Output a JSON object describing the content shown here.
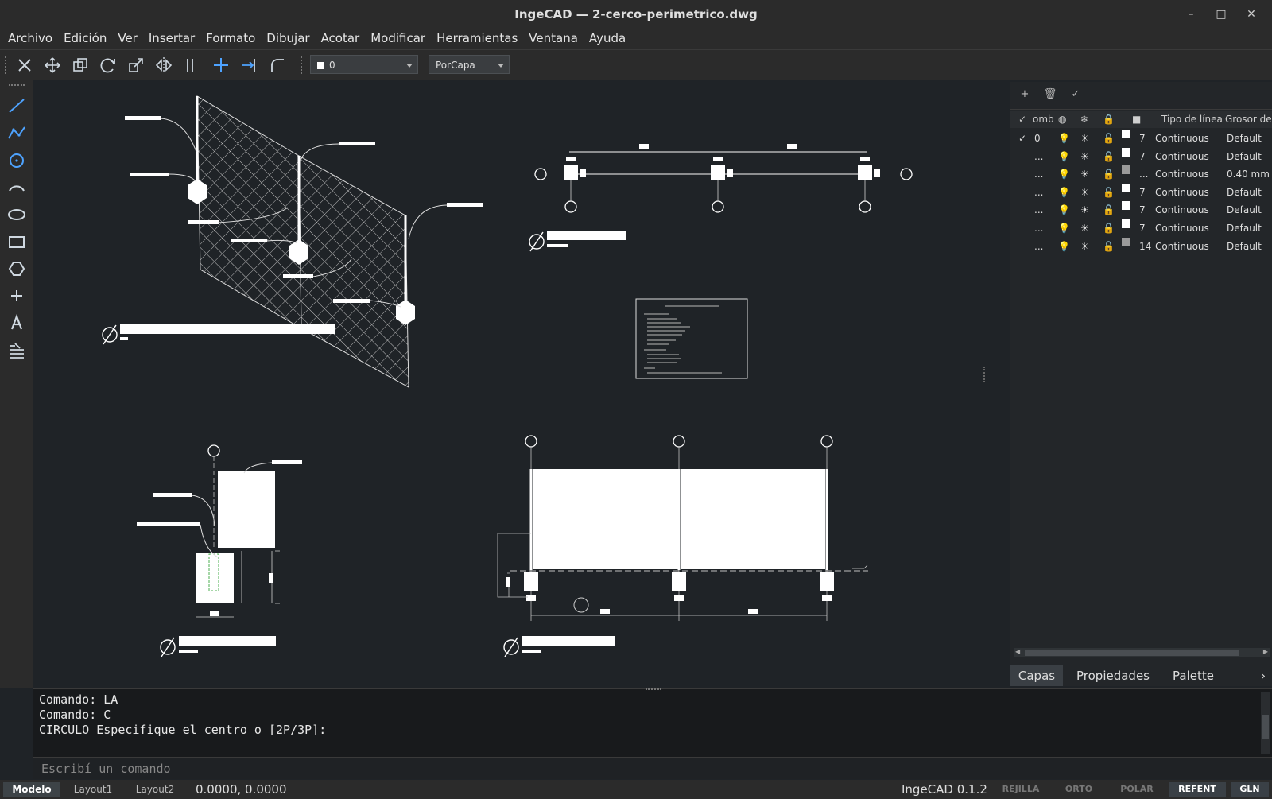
{
  "window": {
    "title": "IngeCAD — 2-cerco-perimetrico.dwg",
    "controls": [
      "–",
      "□",
      "✕"
    ]
  },
  "menu": [
    "Archivo",
    "Edición",
    "Ver",
    "Insertar",
    "Formato",
    "Dibujar",
    "Acotar",
    "Modificar",
    "Herramientas",
    "Ventana",
    "Ayuda"
  ],
  "toolbar": {
    "tools": [
      "erase-icon",
      "move-icon",
      "copy-icon",
      "rotate-icon",
      "scale-icon",
      "mirror-icon",
      "offset-icon",
      "trim-icon",
      "extend-icon",
      "fillet-icon"
    ],
    "layer_value": "0",
    "linetype_value": "PorCapa"
  },
  "left_tools": [
    "line-icon",
    "polyline-icon",
    "circle-icon",
    "arc-icon",
    "ellipse-icon",
    "rectangle-icon",
    "polygon-icon",
    "point-icon",
    "text-icon",
    "hatch-icon"
  ],
  "layers_panel": {
    "toolbar": [
      "+",
      "🗑",
      "✓"
    ],
    "columns": {
      "check": "✓",
      "name": "omb",
      "linetype": "Tipo de línea",
      "lineweight": "Grosor de lí"
    },
    "rows": [
      {
        "current": "✓",
        "name": "0",
        "color": "#ffffff",
        "color_index": "7",
        "linetype": "Continuous",
        "lineweight": "Default"
      },
      {
        "current": "",
        "name": "...",
        "color": "#ffffff",
        "color_index": "7",
        "linetype": "Continuous",
        "lineweight": "Default"
      },
      {
        "current": "",
        "name": "...",
        "color": "#9a9a9a",
        "color_index": "...",
        "linetype": "Continuous",
        "lineweight": "0.40 mm"
      },
      {
        "current": "",
        "name": "...",
        "color": "#ffffff",
        "color_index": "7",
        "linetype": "Continuous",
        "lineweight": "Default"
      },
      {
        "current": "",
        "name": "...",
        "color": "#ffffff",
        "color_index": "7",
        "linetype": "Continuous",
        "lineweight": "Default"
      },
      {
        "current": "",
        "name": "...",
        "color": "#ffffff",
        "color_index": "7",
        "linetype": "Continuous",
        "lineweight": "Default"
      },
      {
        "current": "",
        "name": "...",
        "color": "#9a9a9a",
        "color_index": "14",
        "linetype": "Continuous",
        "lineweight": "Default"
      }
    ],
    "tabs": [
      "Capas",
      "Propiedades",
      "Palette"
    ],
    "more": "›"
  },
  "command": {
    "history": [
      "Comando: LA",
      "Comando: C",
      "CIRCULO Especifique el centro o [2P/3P]:"
    ],
    "placeholder": "Escribí un comando"
  },
  "status": {
    "tabs": [
      "Modelo",
      "Layout1",
      "Layout2"
    ],
    "coords": "0.0000, 0.0000",
    "version": "IngeCAD 0.1.2",
    "toggles": [
      {
        "label": "REJILLA",
        "on": false
      },
      {
        "label": "ORTO",
        "on": false
      },
      {
        "label": "POLAR",
        "on": false
      },
      {
        "label": "REFENT",
        "on": true
      },
      {
        "label": "GLN",
        "on": true
      }
    ]
  },
  "colors": {
    "accent": "#f2c14e",
    "background": "#1f2327",
    "panel": "#2b2b2b"
  }
}
